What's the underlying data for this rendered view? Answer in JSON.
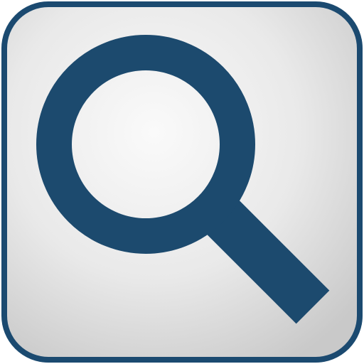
{
  "icon": {
    "name": "search-icon",
    "colors": {
      "frame": "#1b4a70",
      "glyph": "#1c4a6e",
      "tile_center": "#fafafa",
      "tile_edge": "#c9c9c9"
    }
  }
}
